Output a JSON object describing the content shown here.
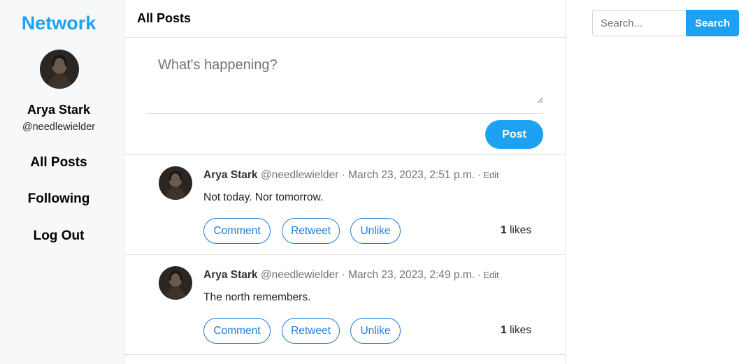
{
  "brand": "Network",
  "profile": {
    "name": "Arya Stark",
    "handle": "@needlewielder"
  },
  "nav": [
    "All Posts",
    "Following",
    "Log Out"
  ],
  "main": {
    "title": "All Posts"
  },
  "compose": {
    "placeholder": "What's happening?",
    "post_label": "Post"
  },
  "posts": [
    {
      "author": "Arya Stark",
      "handle": "@needlewielder",
      "sep": "·",
      "timestamp": "March 23, 2023, 2:51 p.m.",
      "edit_label": "· Edit",
      "body": "Not today. Nor tomorrow.",
      "actions": [
        "Comment",
        "Retweet",
        "Unlike"
      ],
      "likes_count": "1",
      "likes_label": "likes"
    },
    {
      "author": "Arya Stark",
      "handle": "@needlewielder",
      "sep": "·",
      "timestamp": "March 23, 2023, 2:49 p.m.",
      "edit_label": "· Edit",
      "body": "The north remembers.",
      "actions": [
        "Comment",
        "Retweet",
        "Unlike"
      ],
      "likes_count": "1",
      "likes_label": "likes"
    }
  ],
  "search": {
    "placeholder": "Search...",
    "button_label": "Search"
  },
  "colors": {
    "accent": "#1da1f2",
    "link": "#1d7bd8"
  },
  "icons": {
    "avatar": "profile-photo"
  }
}
